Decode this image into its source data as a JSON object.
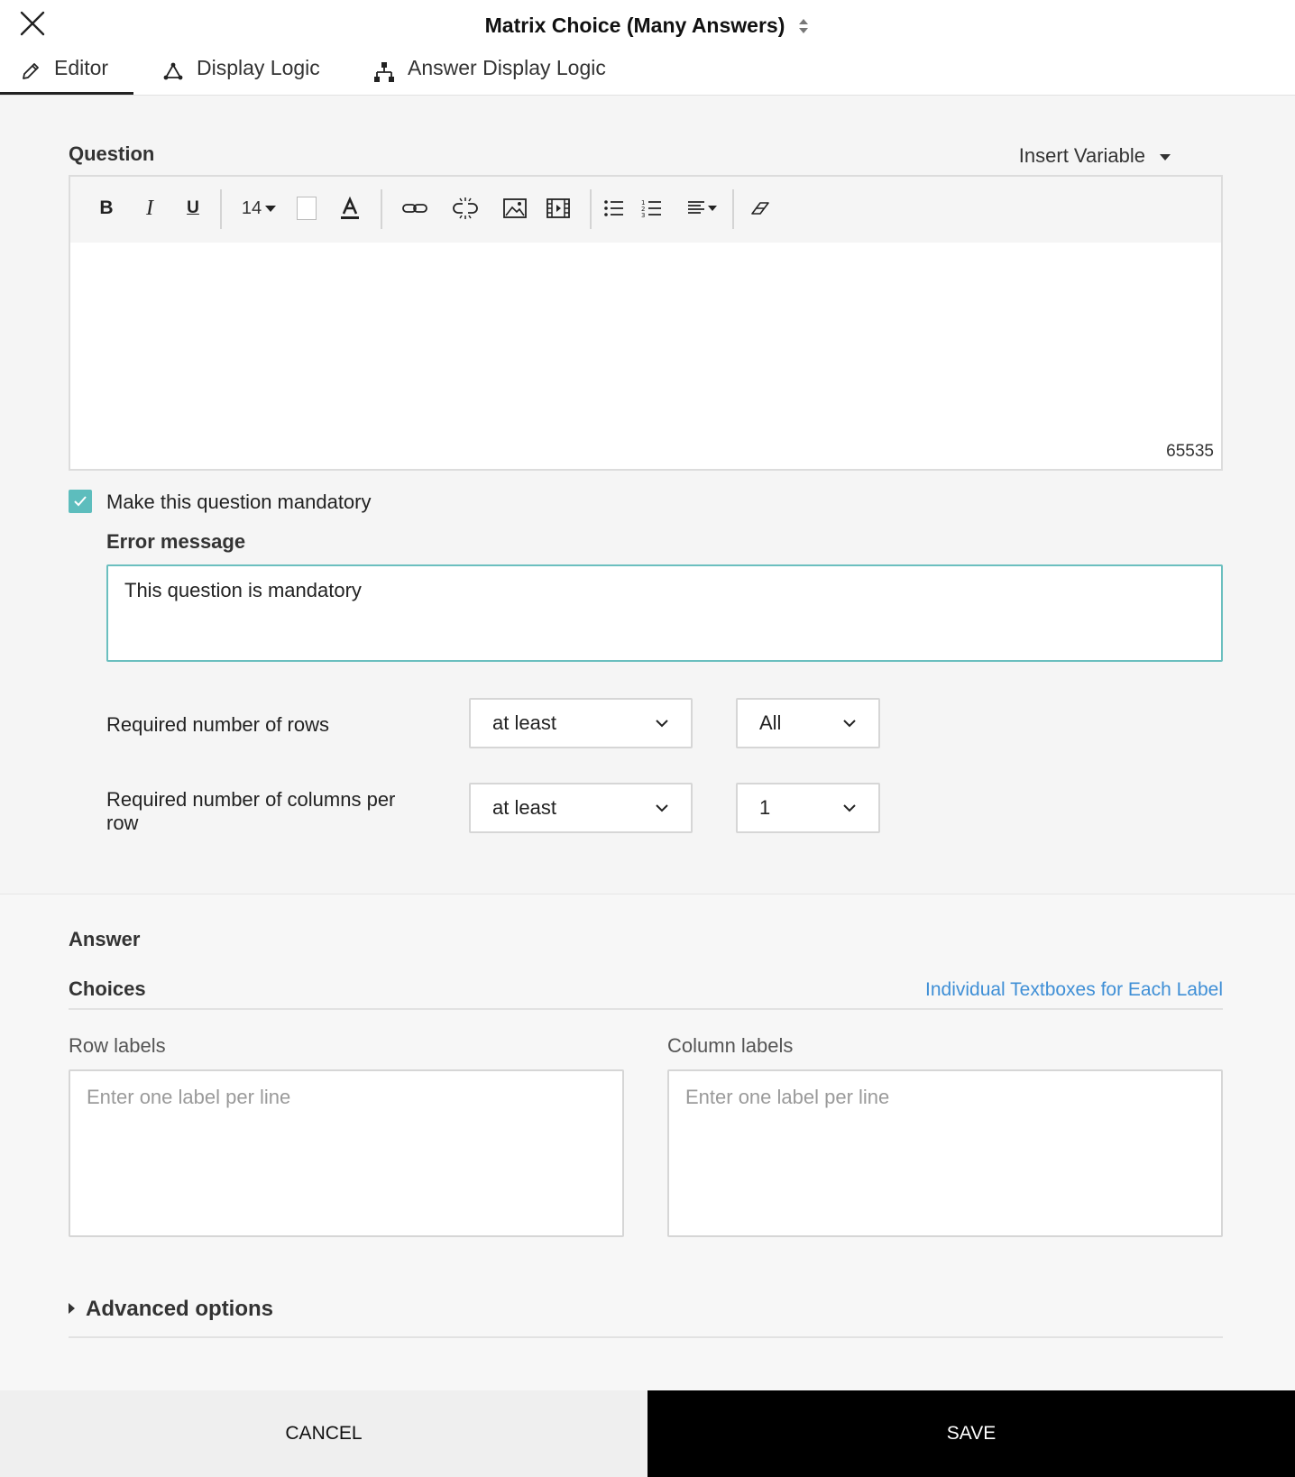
{
  "header": {
    "title": "Matrix Choice (Many Answers)",
    "tabs": [
      {
        "label": "Editor",
        "icon": "pencil-icon"
      },
      {
        "label": "Display Logic",
        "icon": "display-logic-icon"
      },
      {
        "label": "Answer Display Logic",
        "icon": "answer-logic-icon"
      }
    ]
  },
  "question": {
    "section_label": "Question",
    "insert_variable": "Insert Variable",
    "toolbar": {
      "font_size": "14"
    },
    "char_count": "65535",
    "mandatory_label": "Make this question mandatory",
    "mandatory_checked": true,
    "error_message_label": "Error message",
    "error_message_value": "This question is mandatory",
    "rows_label": "Required number of rows",
    "rows_mode": "at least",
    "rows_count": "All",
    "cols_label": "Required number of columns per row",
    "cols_mode": "at least",
    "cols_count": "1"
  },
  "answer": {
    "section_label": "Answer",
    "choices_label": "Choices",
    "individual_link": "Individual Textboxes for Each Label",
    "row_labels": "Row labels",
    "row_placeholder": "Enter one label per line",
    "column_labels": "Column labels",
    "column_placeholder": "Enter one label per line",
    "advanced_options": "Advanced options"
  },
  "footer": {
    "cancel": "CANCEL",
    "save": "SAVE"
  },
  "colors": {
    "accent_teal": "#5dbdbd",
    "link_blue": "#3f8fd6",
    "save_bg": "#000000"
  }
}
